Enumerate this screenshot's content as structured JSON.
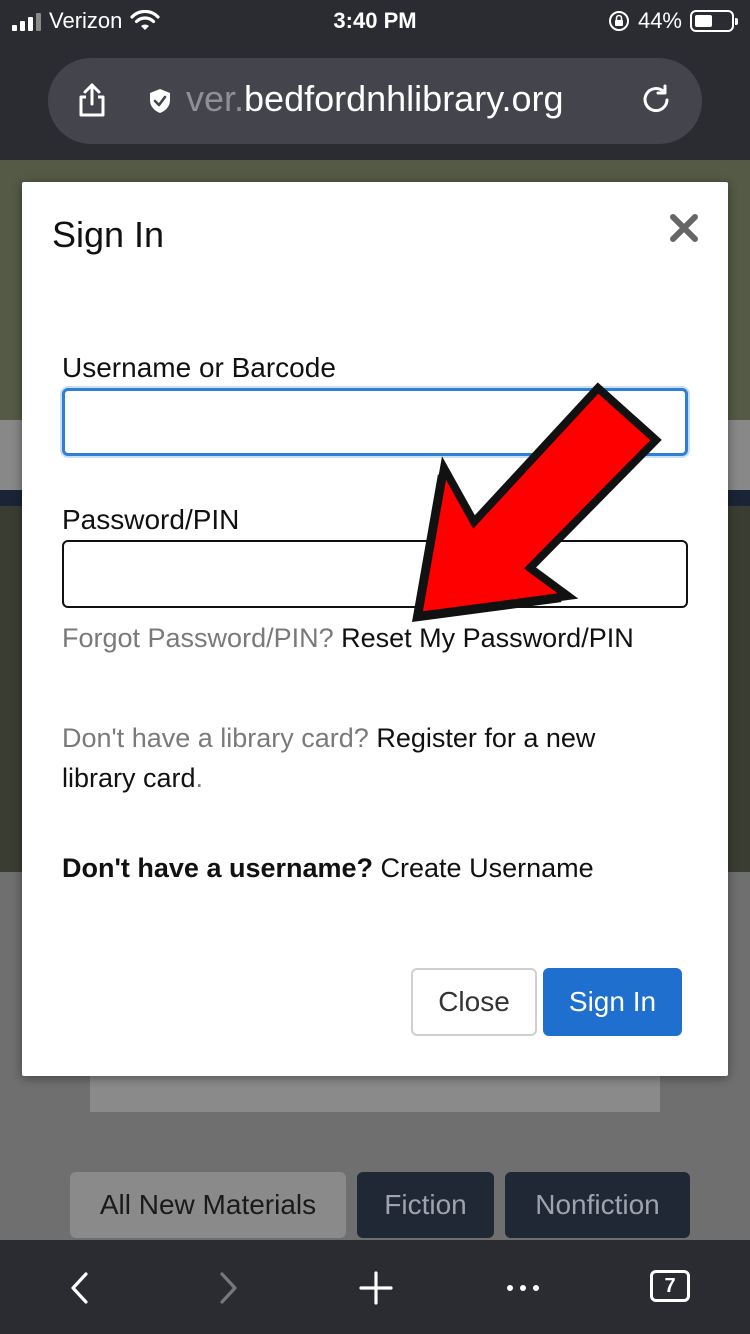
{
  "status_bar": {
    "carrier": "Verizon",
    "time": "3:40 PM",
    "battery_percent": "44%",
    "battery_level": 0.44
  },
  "browser": {
    "url_prefix": "ver.",
    "url_domain": "bedfordnhlibrary.org",
    "toolbar": {
      "tab_count": "7"
    }
  },
  "background": {
    "categories": [
      "All New Materials",
      "Fiction",
      "Nonfiction"
    ]
  },
  "modal": {
    "title": "Sign In",
    "username_label": "Username or Barcode",
    "username_value": "",
    "password_label": "Password/PIN",
    "password_value": "",
    "forgot_text": "Forgot Password/PIN?",
    "reset_link": "Reset My Password/PIN",
    "no_card_text": "Don't have a library card?",
    "register_link": "Register for a new library card",
    "register_period": ".",
    "no_username_text": "Don't have a username?",
    "create_username_link": "Create Username",
    "close_button": "Close",
    "signin_button": "Sign In"
  },
  "annotation": {
    "arrow_color": "#ff0000"
  }
}
